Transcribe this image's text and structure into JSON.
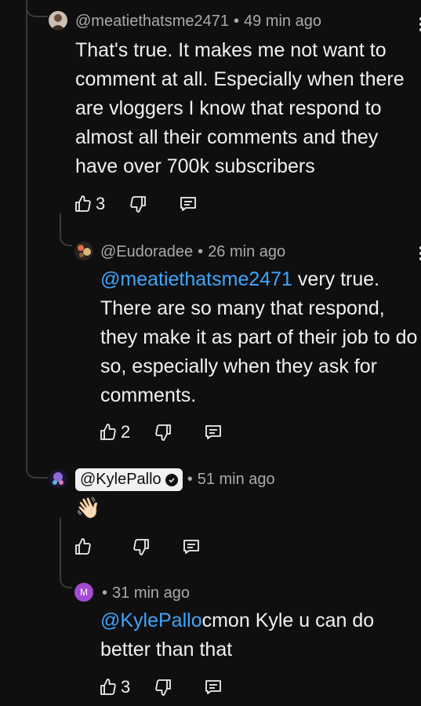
{
  "comments": [
    {
      "handle": "@meatiethatsme2471",
      "time": "49 min ago",
      "text": "That's true. It makes me not want to comment at all. Especially when there are vloggers I know that respond to almost all their comments and they have over 700k subscribers",
      "likes": "3"
    },
    {
      "handle": "@Eudoradee",
      "time": "26 min ago",
      "mention": "@meatiethatsme2471",
      "text": " very true. There are so many that respond, they make it as part of their job to do so, especially when they ask for comments.",
      "likes": "2"
    },
    {
      "handle": "@KylePallo",
      "time": "51 min ago",
      "emoji": "👋🏻",
      "likes": ""
    },
    {
      "avatar_letter": "M",
      "time": "31 min ago",
      "mention": "@KylePallo",
      "text": "cmon Kyle u can do better than that",
      "likes": "3"
    }
  ],
  "separator": "•",
  "colors": {
    "background": "#0f0f0f",
    "text": "#f1f1f1",
    "meta": "#aaaaaa",
    "mention": "#3ea6ff",
    "thread_line": "#3a3a3a",
    "m_avatar": "#a44bd3"
  },
  "icons": {
    "like": "thumbs-up-icon",
    "dislike": "thumbs-down-icon",
    "reply": "reply-comment-icon",
    "menu": "more-vertical-icon",
    "verified": "verified-check-icon"
  }
}
